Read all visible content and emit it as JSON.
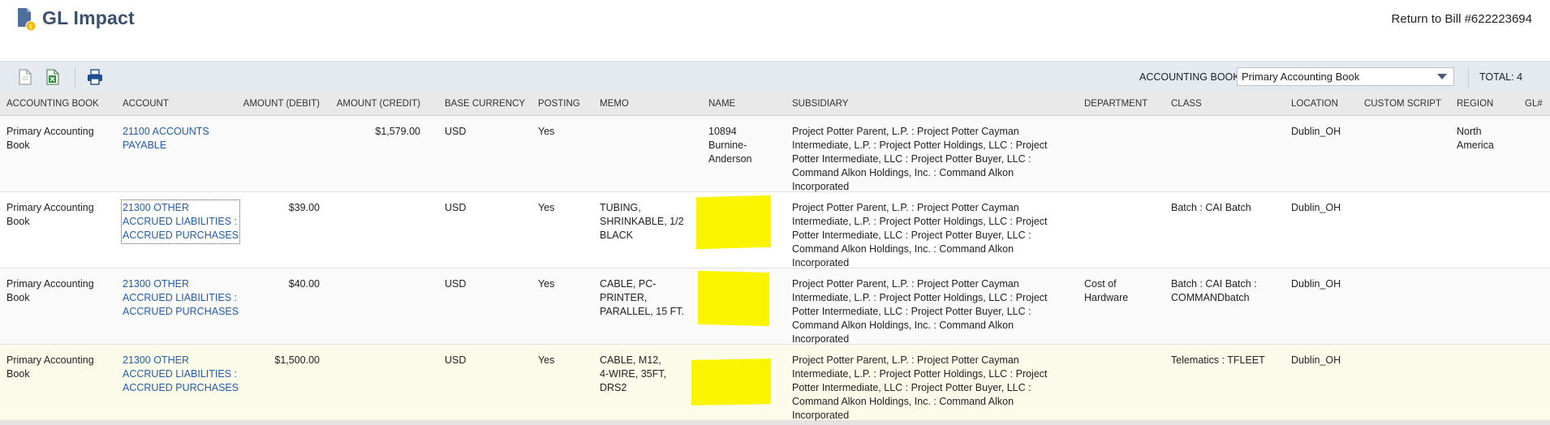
{
  "header": {
    "title": "GL Impact",
    "return_link": "Return to Bill #622223694"
  },
  "toolbar": {
    "book_label": "ACCOUNTING BOOK",
    "book_value": "Primary Accounting Book",
    "total": "TOTAL: 4"
  },
  "columns": {
    "book": "ACCOUNTING BOOK",
    "account": "ACCOUNT",
    "debit": "AMOUNT (DEBIT)",
    "credit": "AMOUNT (CREDIT)",
    "currency": "BASE CURRENCY",
    "posting": "POSTING",
    "memo": "MEMO",
    "name": "NAME",
    "subsidiary": "SUBSIDIARY",
    "department": "DEPARTMENT",
    "class": "CLASS",
    "location": "LOCATION",
    "custom_script": "CUSTOM SCRIPT",
    "region": "REGION",
    "gl_num": "GL#"
  },
  "rows": [
    {
      "book_l1": "Primary Accounting",
      "book_l2": "Book",
      "acct_l1": "21100 ACCOUNTS",
      "acct_l2": "PAYABLE",
      "acct_l3": "",
      "debit": "",
      "credit": "$1,579.00",
      "currency": "USD",
      "posting": "Yes",
      "memo_l1": "",
      "memo_l2": "",
      "memo_l3": "",
      "name_l1": "10894",
      "name_l2": "Burnine-",
      "name_l3": "Anderson",
      "sub_l1": "Project Potter Parent, L.P. : Project Potter Cayman",
      "sub_l2": "Intermediate, L.P. : Project Potter Holdings, LLC : Project",
      "sub_l3": "Potter Intermediate, LLC : Project Potter Buyer, LLC :",
      "sub_l4": "Command Alkon Holdings, Inc. : Command Alkon",
      "sub_l5": "Incorporated",
      "dept_l1": "",
      "dept_l2": "",
      "class_l1": "",
      "class_l2": "",
      "location": "Dublin_OH",
      "region_l1": "North",
      "region_l2": "America"
    },
    {
      "book_l1": "Primary Accounting",
      "book_l2": "Book",
      "acct_l1": "21300 OTHER",
      "acct_l2": "ACCRUED LIABILITIES :",
      "acct_l3": "ACCRUED PURCHASES",
      "debit": "$39.00",
      "credit": "",
      "currency": "USD",
      "posting": "Yes",
      "memo_l1": "TUBING,",
      "memo_l2": "SHRINKABLE, 1/2",
      "memo_l3": "BLACK",
      "name_l1": "",
      "name_l2": "",
      "name_l3": "",
      "sub_l1": "Project Potter Parent, L.P. : Project Potter Cayman",
      "sub_l2": "Intermediate, L.P. : Project Potter Holdings, LLC : Project",
      "sub_l3": "Potter Intermediate, LLC : Project Potter Buyer, LLC :",
      "sub_l4": "Command Alkon Holdings, Inc. : Command Alkon",
      "sub_l5": "Incorporated",
      "dept_l1": "",
      "dept_l2": "",
      "class_l1": "Batch : CAI Batch",
      "class_l2": "",
      "location": "Dublin_OH",
      "region_l1": "",
      "region_l2": ""
    },
    {
      "book_l1": "Primary Accounting",
      "book_l2": "Book",
      "acct_l1": "21300 OTHER",
      "acct_l2": "ACCRUED LIABILITIES :",
      "acct_l3": "ACCRUED PURCHASES",
      "debit": "$40.00",
      "credit": "",
      "currency": "USD",
      "posting": "Yes",
      "memo_l1": "CABLE, PC-",
      "memo_l2": "PRINTER,",
      "memo_l3": "PARALLEL, 15 FT.",
      "name_l1": "",
      "name_l2": "",
      "name_l3": "",
      "sub_l1": "Project Potter Parent, L.P. : Project Potter Cayman",
      "sub_l2": "Intermediate, L.P. : Project Potter Holdings, LLC : Project",
      "sub_l3": "Potter Intermediate, LLC : Project Potter Buyer, LLC :",
      "sub_l4": "Command Alkon Holdings, Inc. : Command Alkon",
      "sub_l5": "Incorporated",
      "dept_l1": "Cost of",
      "dept_l2": "Hardware",
      "class_l1": "Batch : CAI Batch :",
      "class_l2": "COMMANDbatch",
      "location": "Dublin_OH",
      "region_l1": "",
      "region_l2": ""
    },
    {
      "book_l1": "Primary Accounting",
      "book_l2": "Book",
      "acct_l1": "21300 OTHER",
      "acct_l2": "ACCRUED LIABILITIES :",
      "acct_l3": "ACCRUED PURCHASES",
      "debit": "$1,500.00",
      "credit": "",
      "currency": "USD",
      "posting": "Yes",
      "memo_l1": "CABLE, M12,",
      "memo_l2": "4-WIRE, 35FT,",
      "memo_l3": "DRS2",
      "name_l1": "",
      "name_l2": "",
      "name_l3": "",
      "sub_l1": "Project Potter Parent, L.P. : Project Potter Cayman",
      "sub_l2": "Intermediate, L.P. : Project Potter Holdings, LLC : Project",
      "sub_l3": "Potter Intermediate, LLC : Project Potter Buyer, LLC :",
      "sub_l4": "Command Alkon Holdings, Inc. : Command Alkon",
      "sub_l5": "Incorporated",
      "dept_l1": "",
      "dept_l2": "",
      "class_l1": "Telematics : TFLEET",
      "class_l2": "",
      "location": "Dublin_OH",
      "region_l1": "",
      "region_l2": ""
    }
  ]
}
